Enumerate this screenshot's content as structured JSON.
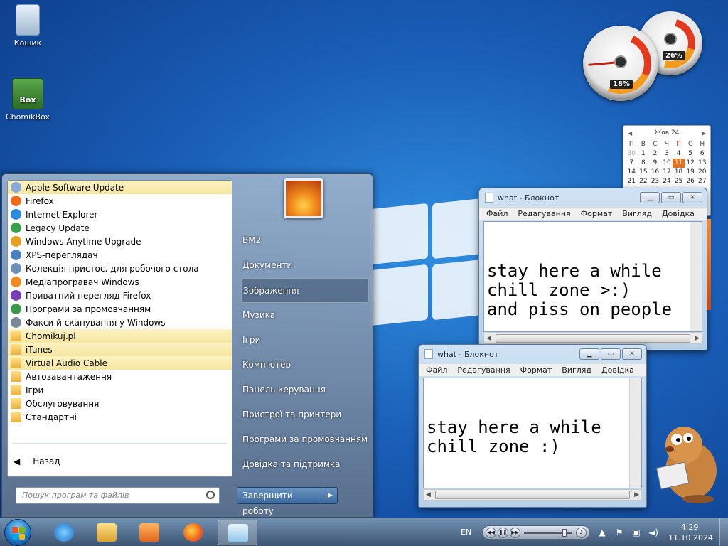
{
  "desktop": {
    "icons": [
      {
        "label": "Кошик",
        "icon": "recycle-bin-icon"
      },
      {
        "label": "ChomikBox",
        "icon": "chomikbox-icon",
        "badge": "Box"
      }
    ]
  },
  "gadgets": {
    "cpu_meter": {
      "cpu": "18%",
      "memory": "26%"
    },
    "calendar": {
      "month": "Жов 24",
      "weekdays": [
        "П",
        "В",
        "С",
        "Ч",
        "П",
        "С",
        "Н"
      ],
      "rows": [
        [
          "30",
          "1",
          "2",
          "3",
          "4",
          "5",
          "6"
        ],
        [
          "7",
          "8",
          "9",
          "10",
          "11",
          "12",
          "13"
        ],
        [
          "14",
          "15",
          "16",
          "17",
          "18",
          "19",
          "20"
        ],
        [
          "21",
          "22",
          "23",
          "24",
          "25",
          "26",
          "27"
        ]
      ],
      "today": "11"
    }
  },
  "notepads": [
    {
      "title": "what - Блокнот",
      "menu": [
        "Файл",
        "Редагування",
        "Формат",
        "Вигляд",
        "Довідка"
      ],
      "text": "stay here a while\nchill zone >:)\nand piss on people"
    },
    {
      "title": "what - Блокнот",
      "menu": [
        "Файл",
        "Редагування",
        "Формат",
        "Вигляд",
        "Довідка"
      ],
      "text": "stay here a while\nchill zone :)"
    }
  ],
  "start_menu": {
    "programs": [
      {
        "label": "Apple Software Update",
        "icon": "apple-update-icon",
        "highlight": true,
        "color": "#8aa8d8"
      },
      {
        "label": "Firefox",
        "icon": "firefox-icon",
        "highlight": false,
        "color": "#f06a1c"
      },
      {
        "label": "Internet Explorer",
        "icon": "internet-explorer-icon",
        "highlight": false,
        "color": "#2a8be0"
      },
      {
        "label": "Legacy Update",
        "icon": "legacy-update-icon",
        "highlight": false,
        "color": "#3aa04a"
      },
      {
        "label": "Windows Anytime Upgrade",
        "icon": "windows-flag-icon",
        "highlight": false,
        "color": "#e6a020"
      },
      {
        "label": "XPS-переглядач",
        "icon": "xps-viewer-icon",
        "highlight": false,
        "color": "#4a7fc0"
      },
      {
        "label": "Колекція пристос. для робочого стола",
        "icon": "gadgets-icon",
        "highlight": false,
        "color": "#6a8fb8"
      },
      {
        "label": "Медіапрогравач Windows",
        "icon": "media-player-icon",
        "highlight": false,
        "color": "#f08a1c"
      },
      {
        "label": "Приватний перегляд Firefox",
        "icon": "firefox-private-icon",
        "highlight": false,
        "color": "#7a3db8"
      },
      {
        "label": "Програми за промовчанням",
        "icon": "default-programs-icon",
        "highlight": false,
        "color": "#3a9a4a"
      },
      {
        "label": "Факси й сканування у Windows",
        "icon": "fax-scan-icon",
        "highlight": false,
        "color": "#7a8a9a"
      },
      {
        "label": "Chomikuj.pl",
        "icon": "folder-icon",
        "highlight": true,
        "color": "#e9b13a"
      },
      {
        "label": "iTunes",
        "icon": "folder-icon",
        "highlight": true,
        "color": "#e9b13a"
      },
      {
        "label": "Virtual Audio Cable",
        "icon": "folder-icon",
        "highlight": true,
        "color": "#e9b13a"
      },
      {
        "label": "Автозавантаження",
        "icon": "folder-icon",
        "highlight": false,
        "color": "#e9b13a"
      },
      {
        "label": "Ігри",
        "icon": "folder-icon",
        "highlight": false,
        "color": "#e9b13a"
      },
      {
        "label": "Обслуговування",
        "icon": "folder-icon",
        "highlight": false,
        "color": "#e9b13a"
      },
      {
        "label": "Стандартні",
        "icon": "folder-icon",
        "highlight": false,
        "color": "#e9b13a"
      }
    ],
    "back_label": "Назад",
    "search_placeholder": "Пошук програм та файлів",
    "user_name": "BM2",
    "right_items": [
      "BM2",
      "Документи",
      "Зображення",
      "Музика",
      "Ігри",
      "Комп'ютер",
      "Панель керування",
      "Пристрої та принтери",
      "Програми за промовчанням",
      "Довідка та підтримка"
    ],
    "shutdown_label": "Завершити роботу"
  },
  "taskbar": {
    "pinned": [
      "internet-explorer-icon",
      "explorer-icon",
      "media-player-icon",
      "firefox-icon",
      "notepad-icon"
    ],
    "language": "EN",
    "time": "4:29",
    "date": "11.10.2024"
  }
}
